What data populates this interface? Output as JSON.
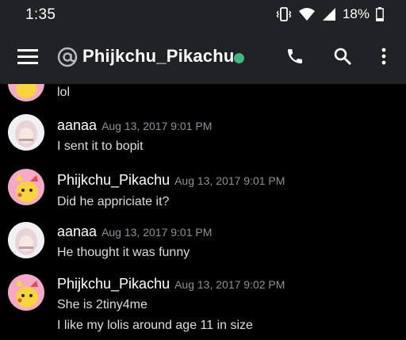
{
  "status_bar": {
    "time": "1:35",
    "battery": "18%",
    "icons": [
      "vibrate-icon",
      "wifi-icon",
      "signal-icon",
      "battery-icon"
    ]
  },
  "app_bar": {
    "channel_name": "Phijkchu_Pikachu",
    "status_color": "#43b581",
    "icons": [
      "menu-icon",
      "at-icon",
      "call-icon",
      "search-icon",
      "more-icon"
    ]
  },
  "colors": {
    "bar_background": "#202225",
    "chat_background": "#000000",
    "timestamp": "#8e9297",
    "message_text": "#dcddde"
  },
  "messages": [
    {
      "author": "",
      "time": "",
      "lines": [
        "lol"
      ]
    },
    {
      "author": "aanaa",
      "time": "Aug 13, 2017 9:01 PM",
      "lines": [
        "I sent it to bopit"
      ]
    },
    {
      "author": "Phijkchu_Pikachu",
      "time": "Aug 13, 2017 9:01 PM",
      "lines": [
        "Did he appriciate it?"
      ]
    },
    {
      "author": "aanaa",
      "time": "Aug 13, 2017 9:01 PM",
      "lines": [
        "He thought it was funny"
      ]
    },
    {
      "author": "Phijkchu_Pikachu",
      "time": "Aug 13, 2017 9:02 PM",
      "lines": [
        "She is 2tiny4me",
        "I like my lolis around age 11 in size"
      ]
    }
  ]
}
